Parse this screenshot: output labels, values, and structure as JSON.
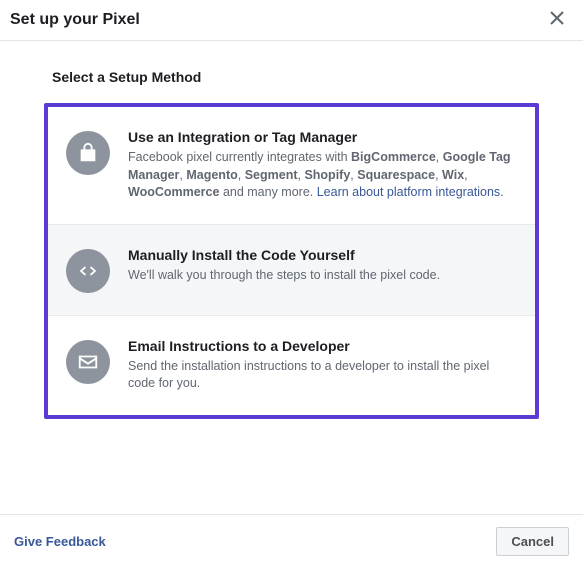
{
  "header": {
    "title": "Set up your Pixel"
  },
  "body": {
    "section_title": "Select a Setup Method",
    "options": [
      {
        "title": "Use an Integration or Tag Manager",
        "desc_pre": "Facebook pixel currently integrates with ",
        "platforms": [
          "BigCommerce",
          "Google Tag Manager",
          "Magento",
          "Segment",
          "Shopify",
          "Squarespace",
          "Wix",
          "WooCommerce"
        ],
        "desc_post": " and many more. ",
        "link": "Learn about platform integrations."
      },
      {
        "title": "Manually Install the Code Yourself",
        "desc": "We'll walk you through the steps to install the pixel code."
      },
      {
        "title": "Email Instructions to a Developer",
        "desc": "Send the installation instructions to a developer to install the pixel code for you."
      }
    ]
  },
  "footer": {
    "feedback": "Give Feedback",
    "cancel": "Cancel"
  }
}
